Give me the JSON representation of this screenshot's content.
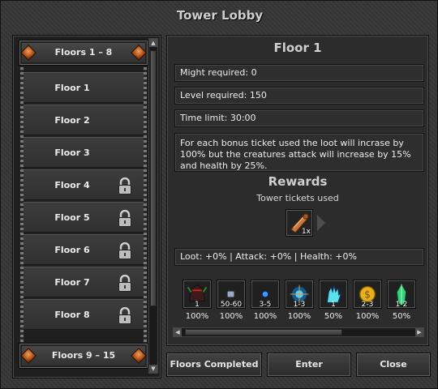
{
  "window": {
    "title": "Tower Lobby"
  },
  "floor_list": {
    "groups": [
      {
        "label": "Floors 1 – 8"
      },
      {
        "label": "Floors 9 – 15"
      }
    ],
    "floors": [
      {
        "label": "Floor 1",
        "locked": false
      },
      {
        "label": "Floor 2",
        "locked": false
      },
      {
        "label": "Floor 3",
        "locked": false
      },
      {
        "label": "Floor 4",
        "locked": true
      },
      {
        "label": "Floor 5",
        "locked": true
      },
      {
        "label": "Floor 6",
        "locked": true
      },
      {
        "label": "Floor 7",
        "locked": true
      },
      {
        "label": "Floor 8",
        "locked": true
      }
    ]
  },
  "detail": {
    "title": "Floor 1",
    "might": "Might required: 0",
    "level": "Level required: 150",
    "time": "Time limit: 30:00",
    "description": "For each bonus ticket used the loot will incrase by 100% but the creatures attack will increase by 15% and health by 25%.",
    "rewards_title": "Rewards",
    "tickets_label": "Tower tickets used",
    "ticket_count": "1x",
    "modifiers": "Loot: +0% | Attack: +0% | Health: +0%"
  },
  "rewards": [
    {
      "icon": "dark-helmet-icon",
      "qty": "1",
      "chance": "100%"
    },
    {
      "icon": "small-gem-icon",
      "qty": "50-60",
      "chance": "100%"
    },
    {
      "icon": "blue-gem-icon",
      "qty": "3-5",
      "chance": "100%"
    },
    {
      "icon": "magic-orb-icon",
      "qty": "1-3",
      "chance": "100%"
    },
    {
      "icon": "crystal-hand-icon",
      "qty": "1",
      "chance": "50%"
    },
    {
      "icon": "gold-coin-icon",
      "qty": "2-3",
      "chance": "100%"
    },
    {
      "icon": "green-crystal-icon",
      "qty": "1-2",
      "chance": "50%"
    }
  ],
  "buttons": {
    "floors_completed": "Floors Completed",
    "enter": "Enter",
    "close": "Close"
  }
}
